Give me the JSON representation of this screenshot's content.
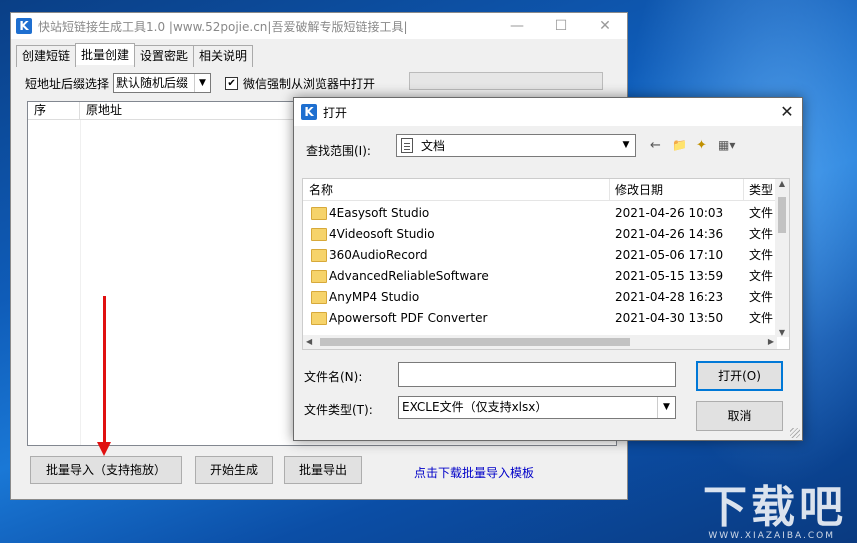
{
  "main_window": {
    "title": "快站短链接生成工具1.0 |www.52pojie.cn|吾爱破解专版短链接工具|",
    "tabs": [
      "创建短链",
      "批量创建",
      "设置密匙",
      "相关说明"
    ],
    "suffix_label": "短地址后缀选择",
    "suffix_value": "默认随机后缀",
    "wechat_label": "微信强制从浏览器中打开",
    "wechat_checked": true,
    "list_headers": [
      "序",
      "原地址"
    ],
    "buttons": {
      "import": "批量导入（支持拖放）",
      "generate": "开始生成",
      "export": "批量导出"
    },
    "download_link": "点击下载批量导入模板"
  },
  "dialog": {
    "title": "打开",
    "look_in_label": "查找范围(I):",
    "look_in_value": "文档",
    "columns": [
      "名称",
      "修改日期",
      "类型"
    ],
    "files": [
      {
        "name": "4Easysoft Studio",
        "date": "2021-04-26 10:03",
        "type": "文件"
      },
      {
        "name": "4Videosoft Studio",
        "date": "2021-04-26 14:36",
        "type": "文件"
      },
      {
        "name": "360AudioRecord",
        "date": "2021-05-06 17:10",
        "type": "文件"
      },
      {
        "name": "AdvancedReliableSoftware",
        "date": "2021-05-15 13:59",
        "type": "文件"
      },
      {
        "name": "AnyMP4 Studio",
        "date": "2021-04-28 16:23",
        "type": "文件"
      },
      {
        "name": "Apowersoft PDF Converter",
        "date": "2021-04-30 13:50",
        "type": "文件"
      }
    ],
    "filename_label": "文件名(N):",
    "filename_value": "",
    "filetype_label": "文件类型(T):",
    "filetype_value": "EXCLE文件（仅支持xlsx）",
    "open_button": "打开(O)",
    "cancel_button": "取消"
  },
  "icons": {
    "app_logo_letter": "K",
    "back": "←",
    "up_folder": "📁",
    "new_folder": "✦",
    "view_menu": "▦▾"
  },
  "watermark": {
    "text": "下载吧",
    "subtext": "WWW.XIAZAIBA.COM"
  },
  "colors": {
    "arrow": "#e01010",
    "link": "#0000c8",
    "accent": "#0078d7"
  }
}
